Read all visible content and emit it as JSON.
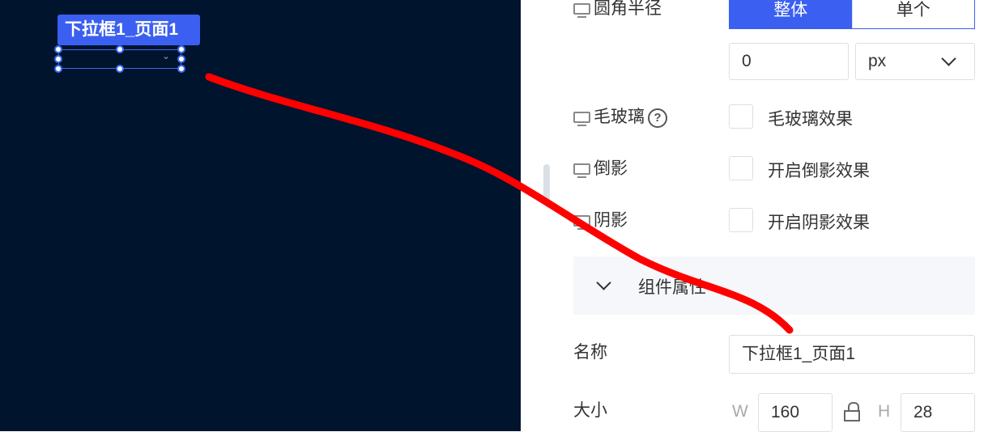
{
  "canvas": {
    "background": "#00142e",
    "selected_component": {
      "label": "下拉框1_页面1",
      "dropdown_icon": "chevron-down-icon"
    }
  },
  "panel": {
    "corner_radius": {
      "label": "圆角半径",
      "icon": "monitor-icon",
      "toggle_whole": "整体",
      "toggle_single": "单个",
      "value": "0",
      "unit": "px",
      "unit_icon": "chevron-down-icon"
    },
    "frosted_glass": {
      "label": "毛玻璃",
      "icon": "monitor-icon",
      "help_icon": "question-circle-icon",
      "help_glyph": "?",
      "checkbox_label": "毛玻璃效果",
      "checked": false
    },
    "reflection": {
      "label": "倒影",
      "icon": "monitor-icon",
      "checkbox_label": "开启倒影效果",
      "checked": false
    },
    "shadow": {
      "label": "阴影",
      "icon": "monitor-icon",
      "checkbox_label": "开启阴影效果",
      "checked": false
    },
    "component_props": {
      "title": "组件属性",
      "expanded": true,
      "collapse_icon": "chevron-down-icon"
    },
    "name": {
      "label": "名称",
      "value": "下拉框1_页面1"
    },
    "size": {
      "label": "大小",
      "w_label": "W",
      "w_value": "160",
      "lock_icon": "unlock-icon",
      "h_label": "H",
      "h_value": "28"
    }
  },
  "colors": {
    "accent": "#3b5ff0",
    "annotation_stroke": "#ff0000"
  }
}
